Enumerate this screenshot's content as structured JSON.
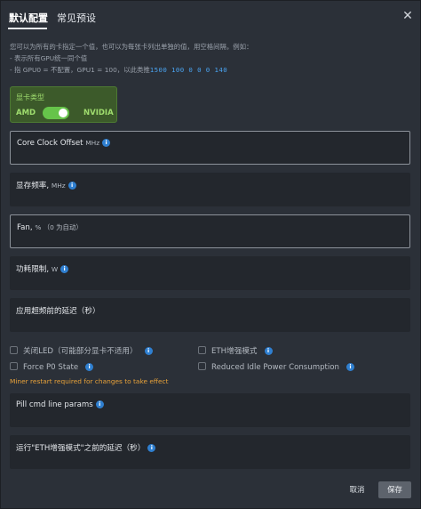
{
  "tabs": [
    {
      "label": "默认配置"
    },
    {
      "label": "常见预设"
    }
  ],
  "help": {
    "line1": "您可以为所有的卡指定一个值，也可以为每张卡列出单独的值，用空格间隔，例如：",
    "line2": "- 表示所有GPU统一同个值",
    "line3_prefix": "- 指 GPU0 = 不配置，GPU1 = 100，以此类推",
    "line3_example": "1500 100 0 0 0 140"
  },
  "gpu_type": {
    "title": "显卡类型",
    "amd": "AMD",
    "nvidia": "NVIDIA",
    "selected": "NVIDIA"
  },
  "fields": {
    "core_clock": {
      "label": "Core Clock Offset",
      "unit": "MHz"
    },
    "mem_clock": {
      "label": "显存频率,",
      "unit": "MHz"
    },
    "fan": {
      "label": "Fan,",
      "unit": "%  （0 为自动）"
    },
    "power_limit": {
      "label": "功耗限制,",
      "unit": "W"
    },
    "apply_delay": {
      "label": "应用超频前的延迟（秒）"
    },
    "pill_params": {
      "label": "Pill cmd line params"
    },
    "eth_delay": {
      "label": "运行\"ETH增强模式\"之前的延迟（秒）"
    }
  },
  "checkboxes": {
    "close_led": "关闭LED（可能部分显卡不适用）",
    "eth_boost": "ETH增强模式",
    "force_p0": "Force P0 State",
    "reduced_idle": "Reduced Idle Power Consumption"
  },
  "warning": "Miner restart required for changes to take effect",
  "buttons": {
    "cancel": "取消",
    "save": "保存"
  },
  "icons": {
    "close": "close-icon",
    "info": "i"
  },
  "colors": {
    "background": "#2b3038",
    "gpu_box": "#3c5a2a",
    "toggle_on": "#66c44a",
    "info_blue": "#2f7fd0",
    "warning": "#e8a23a"
  }
}
